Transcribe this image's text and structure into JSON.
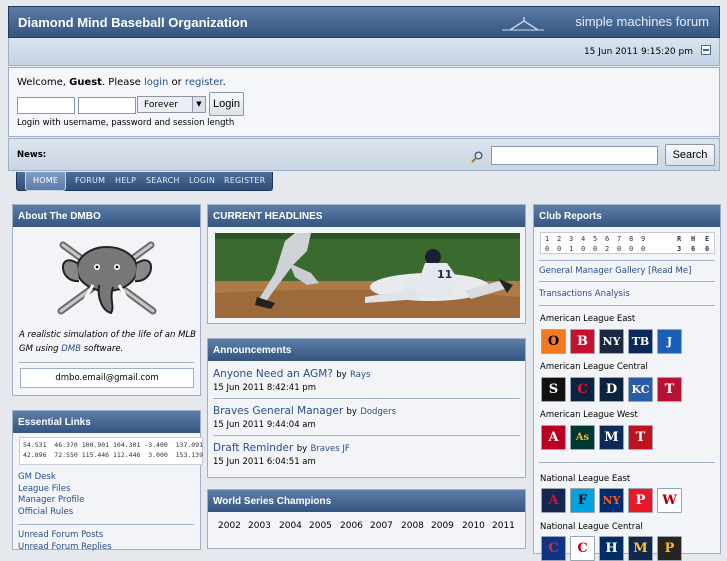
{
  "header": {
    "site_title": "Diamond Mind Baseball Organization",
    "forum_logo": "simple machines forum",
    "datetime": "15 Jun 2011 9:15:20 pm"
  },
  "login": {
    "welcome_prefix": "Welcome, ",
    "guest": "Guest",
    "please": ". Please ",
    "login_link": "login",
    "or": " or ",
    "register_link": "register",
    "period": ".",
    "session_length": "Forever",
    "login_button": "Login",
    "note": "Login with username, password and session length"
  },
  "news": {
    "label": "News:",
    "search_button": "Search"
  },
  "menu": [
    "HOME",
    "FORUM",
    "HELP",
    "SEARCH",
    "LOGIN",
    "REGISTER"
  ],
  "about": {
    "title": "About The DMBO",
    "text_a": "A realistic simulation of the life of an MLB GM using ",
    "text_link": "DMB",
    "text_b": " software.",
    "email": "dmbo.email@gmail.com"
  },
  "essential": {
    "title": "Essential Links",
    "stats_row1": "54.531  46.370 100.901 104.301 -3.400  137.091",
    "stats_row2": "42.896  72.550 115.446 112.446  3.000  153.139",
    "links": [
      "GM Desk",
      "League Files",
      "Manager Profile",
      "Official Rules"
    ],
    "links2": [
      "Unread Forum Posts",
      "Unread Forum Replies"
    ]
  },
  "headlines": {
    "title": "CURRENT HEADLINES",
    "jersey_number": "11"
  },
  "announcements": {
    "title": "Announcements",
    "items": [
      {
        "title": "Anyone Need an AGM?",
        "by": "by",
        "author": "Rays",
        "date": "15 Jun 2011 8:42:41 pm"
      },
      {
        "title": "Braves General Manager",
        "by": "by",
        "author": "Dodgers",
        "date": "15 Jun 2011 9:44:04 am"
      },
      {
        "title": "Draft Reminder",
        "by": "by",
        "author": "Braves JF",
        "date": "15 Jun 2011 6:04:51 am"
      }
    ]
  },
  "champions": {
    "title": "World Series Champions",
    "years": [
      "2002",
      "2003",
      "2004",
      "2005",
      "2006",
      "2007",
      "2008",
      "2009",
      "2010",
      "2011"
    ]
  },
  "club": {
    "title": "Club Reports",
    "innings": [
      "1",
      "2",
      "3",
      "4",
      "5",
      "6",
      "7",
      "8",
      "9"
    ],
    "scores": [
      "0",
      "0",
      "1",
      "0",
      "0",
      "2",
      "0",
      "0",
      "0"
    ],
    "rhe_labels": [
      "R",
      "H",
      "E"
    ],
    "rhe_values": [
      "3",
      "6",
      "0"
    ],
    "gallery_link": "General Manager Gallery [Read Me]",
    "transactions_link": "Transactions Analysis",
    "leagues": [
      {
        "name": "American League East",
        "teams": [
          "O",
          "B",
          "NY",
          "TB",
          "J"
        ]
      },
      {
        "name": "American League Central",
        "teams": [
          "S",
          "C",
          "D",
          "KC",
          "T"
        ]
      },
      {
        "name": "American League West",
        "teams": [
          "A",
          "As",
          "M",
          "T"
        ]
      },
      {
        "name": "National League East",
        "teams": [
          "A",
          "F",
          "NY",
          "P",
          "W"
        ]
      },
      {
        "name": "National League Central",
        "teams": [
          "C",
          "C",
          "H",
          "M",
          "P"
        ]
      }
    ]
  },
  "colors": {
    "header_blue": "#34557f",
    "link_blue": "#2b4e8c",
    "panel_bg": "#f2f4f7"
  }
}
